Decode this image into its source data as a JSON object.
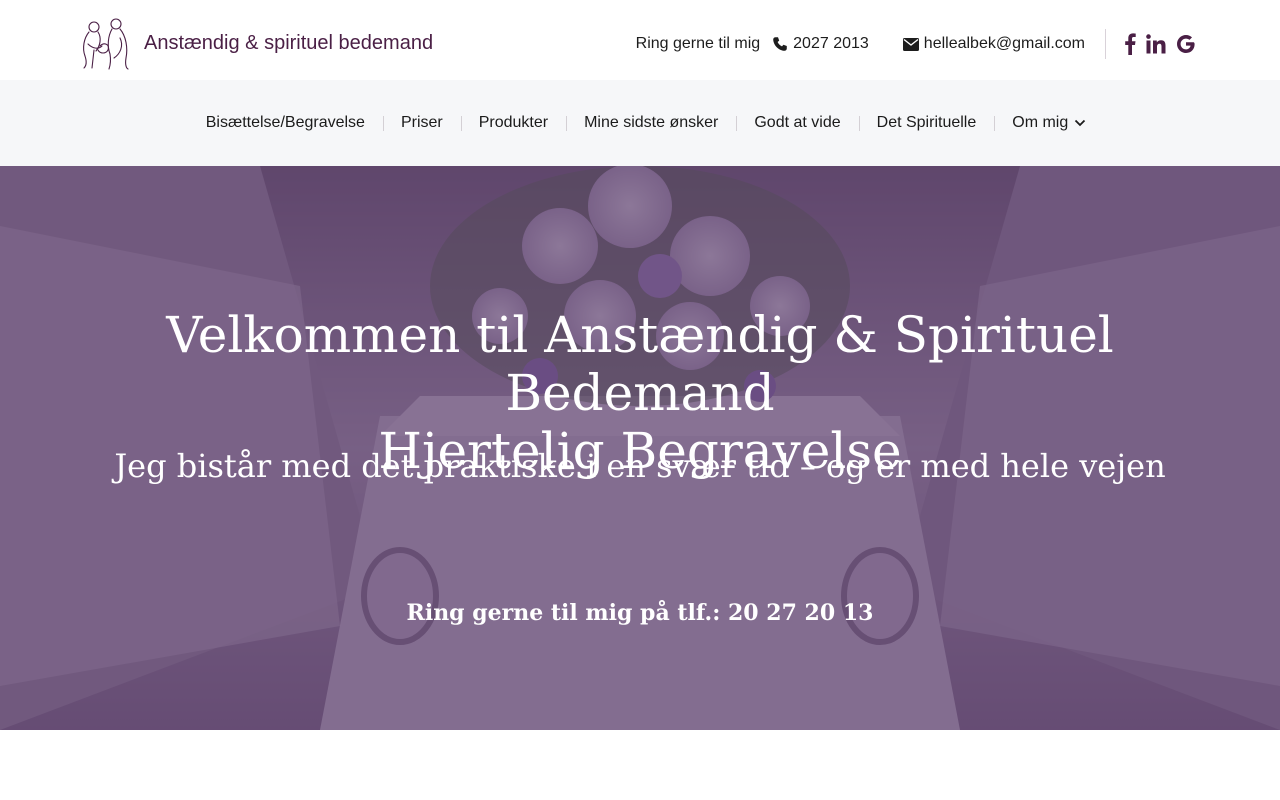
{
  "header": {
    "site_title": "Anstændig & spirituel bedemand",
    "logo_icon": "couple-line-art-logo",
    "call_label": "Ring gerne til mig",
    "phone": "2027 2013",
    "phone_icon": "phone-icon",
    "email": "hellealbek@gmail.com",
    "email_icon": "envelope-icon",
    "social": [
      "facebook-icon",
      "linkedin-icon",
      "google-icon"
    ],
    "brand_color": "#4a1f45"
  },
  "nav": {
    "items": [
      {
        "label": "Bisættelse/Begravelse"
      },
      {
        "label": "Priser"
      },
      {
        "label": "Produkter"
      },
      {
        "label": "Mine sidste ønsker"
      },
      {
        "label": "Godt at vide"
      },
      {
        "label": "Det Spirituelle"
      },
      {
        "label": "Om mig",
        "has_dropdown": true
      }
    ],
    "background": "#f6f7f9"
  },
  "hero": {
    "title_line1": "Velkommen til Anstændig & Spirituel Bedemand",
    "title_line2": "Hjertelig Begravelse",
    "subtitle": "Jeg bistår med det praktiske i en svær tid – og er med hele vejen",
    "call_text": "Ring gerne til mig på tlf.: 20 27 20 13",
    "overlay_color": "#462458"
  }
}
